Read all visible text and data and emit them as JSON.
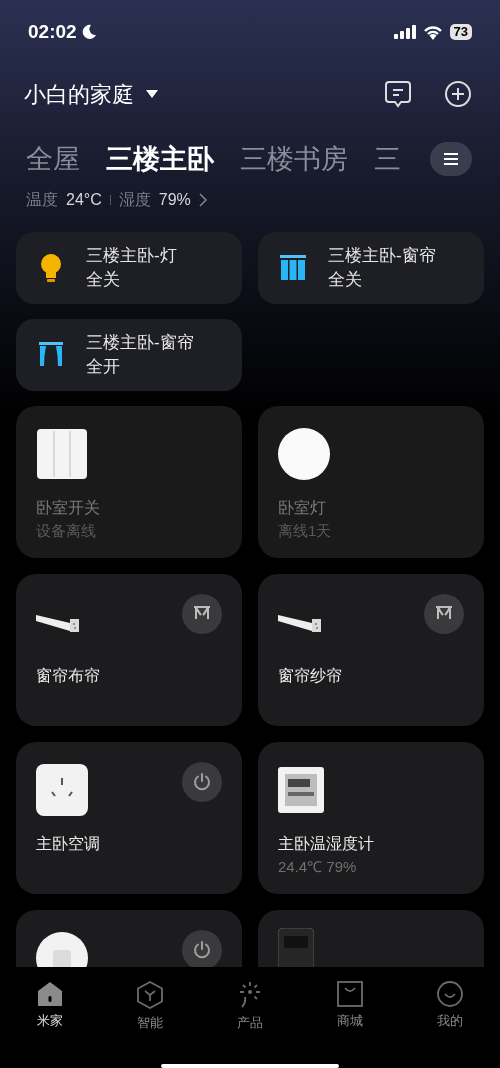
{
  "status_bar": {
    "time": "02:02",
    "battery": "73"
  },
  "header": {
    "home_name": "小白的家庭"
  },
  "rooms": [
    {
      "label": "全屋",
      "selected": false
    },
    {
      "label": "三楼主卧",
      "selected": true
    },
    {
      "label": "三楼书房",
      "selected": false
    },
    {
      "label": "三",
      "selected": false
    }
  ],
  "climate": {
    "temp_label": "温度",
    "temp": "24°C",
    "humidity_label": "湿度",
    "humidity": "79%"
  },
  "scenes": [
    {
      "kind": "bulb",
      "title": "三楼主卧-灯",
      "subtitle": "全关"
    },
    {
      "kind": "blinds",
      "title": "三楼主卧-窗帘",
      "subtitle": "全关"
    },
    {
      "kind": "curtain",
      "title": "三楼主卧-窗帘",
      "subtitle": "全开"
    }
  ],
  "devices": [
    {
      "kind": "switch",
      "name": "卧室开关",
      "status": "设备离线",
      "offline": true
    },
    {
      "kind": "lamp",
      "name": "卧室灯",
      "status": "离线1天",
      "offline": true
    },
    {
      "kind": "motor",
      "name": "窗帘布帘",
      "button": {
        "kind": "curtain"
      },
      "offline": false
    },
    {
      "kind": "motor",
      "name": "窗帘纱帘",
      "button": {
        "kind": "curtain"
      },
      "offline": false
    },
    {
      "kind": "plug",
      "name": "主卧空调",
      "button": {
        "kind": "power"
      },
      "offline": false
    },
    {
      "kind": "thermometer",
      "name": "主卧温湿度计",
      "status": "24.4℃ 79%",
      "offline": false
    },
    {
      "kind": "round-plug",
      "button": {
        "kind": "power"
      }
    },
    {
      "kind": "speaker"
    }
  ],
  "nav": [
    {
      "kind": "home",
      "label": "米家",
      "selected": true
    },
    {
      "kind": "smart",
      "label": "智能",
      "selected": false
    },
    {
      "kind": "product",
      "label": "产品",
      "selected": false
    },
    {
      "kind": "store",
      "label": "商城",
      "selected": false
    },
    {
      "kind": "me",
      "label": "我的",
      "selected": false
    }
  ]
}
